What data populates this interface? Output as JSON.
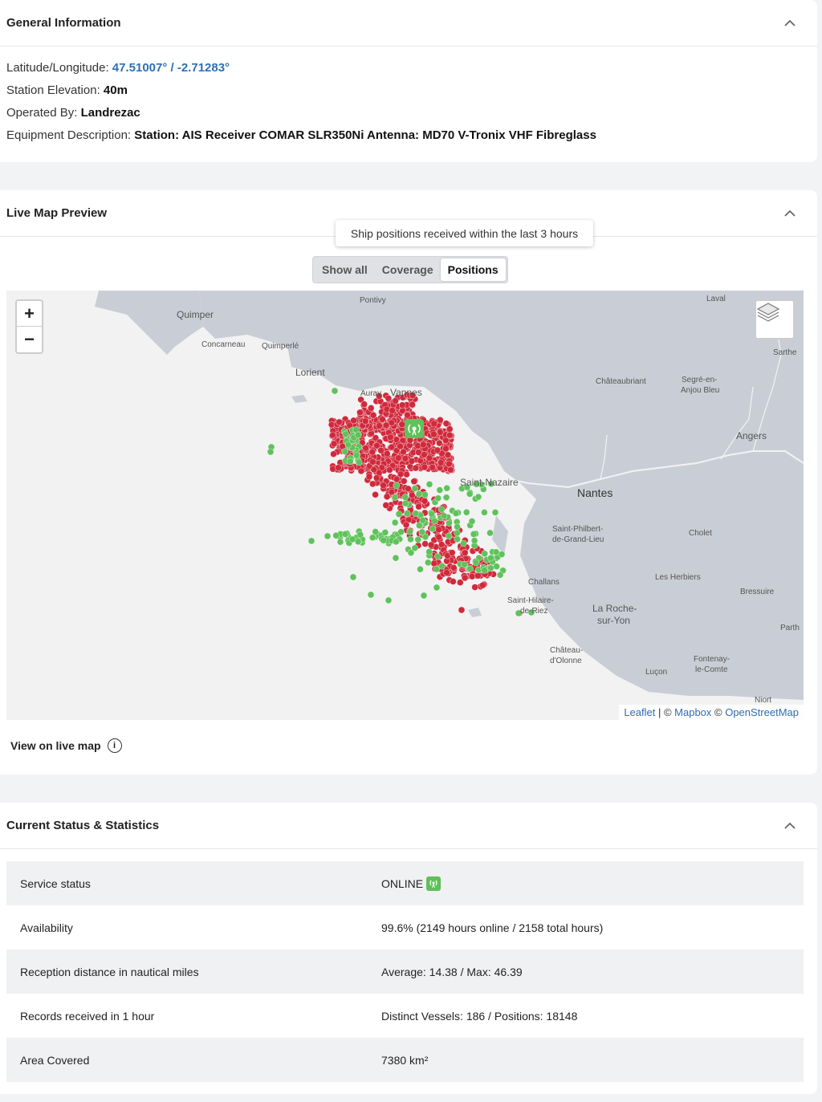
{
  "general": {
    "title": "General Information",
    "lat_label": "Latitude/Longitude: ",
    "lat_value": "47.51007° / -2.71283°",
    "elev_label": "Station Elevation: ",
    "elev_value": "40m",
    "operated_label": "Operated By: ",
    "operated_value": "Landrezac",
    "equip_label": "Equipment Description: ",
    "equip_value": "Station: AIS Receiver COMAR SLR350Ni Antenna: MD70 V-Tronix VHF Fibreglass"
  },
  "map_card": {
    "title": "Live Map Preview",
    "tooltip": "Ship positions received within the last 3 hours",
    "toggle": [
      "Show all",
      "Coverage",
      "Positions"
    ],
    "active_toggle": "Positions",
    "zoom_in": "+",
    "zoom_out": "−",
    "attribution": {
      "leaflet": "Leaflet",
      "sep1": " | © ",
      "mapbox": "Mapbox",
      "sep2": " © ",
      "osm": "OpenStreetMap"
    },
    "view_live": "View on live map",
    "info_glyph": "i",
    "places": [
      "Quimper",
      "Concarneau",
      "Quimperlé",
      "Pontivy",
      "Lorient",
      "Auray",
      "Vannes",
      "Châteaubriant",
      "Segré-en-",
      "Anjou Bleu",
      "Angers",
      "Sarthe",
      "Saint-Nazaire",
      "Nantes",
      "Saint-Philbert-",
      "de-Grand-Lieu",
      "Cholet",
      "Les Herbiers",
      "Bressuire",
      "Challans",
      "Saint-Hilaire-",
      "de-Riez",
      "La Roche-",
      "sur-Yon",
      "Château-",
      "d'Olonne",
      "Luçon",
      "Fontenay-",
      "le-Comte",
      "Niort",
      "Parth",
      "Laval"
    ],
    "colors": {
      "received": "#d0293b",
      "station": "#5fc25a",
      "land": "#c9ced6",
      "sea": "#f2f2f3"
    }
  },
  "stats": {
    "title": "Current Status & Statistics",
    "rows": [
      {
        "key": "Service status",
        "value": "ONLINE"
      },
      {
        "key": "Availability",
        "value": "99.6% (2149 hours online / 2158 total hours)"
      },
      {
        "key": "Reception distance in nautical miles",
        "value": "Average: 14.38 / Max: 46.39"
      },
      {
        "key": "Records received in 1 hour",
        "value": "Distinct Vessels: 186 / Positions: 18148"
      },
      {
        "key": "Area Covered",
        "value": "7380 km²"
      }
    ]
  }
}
